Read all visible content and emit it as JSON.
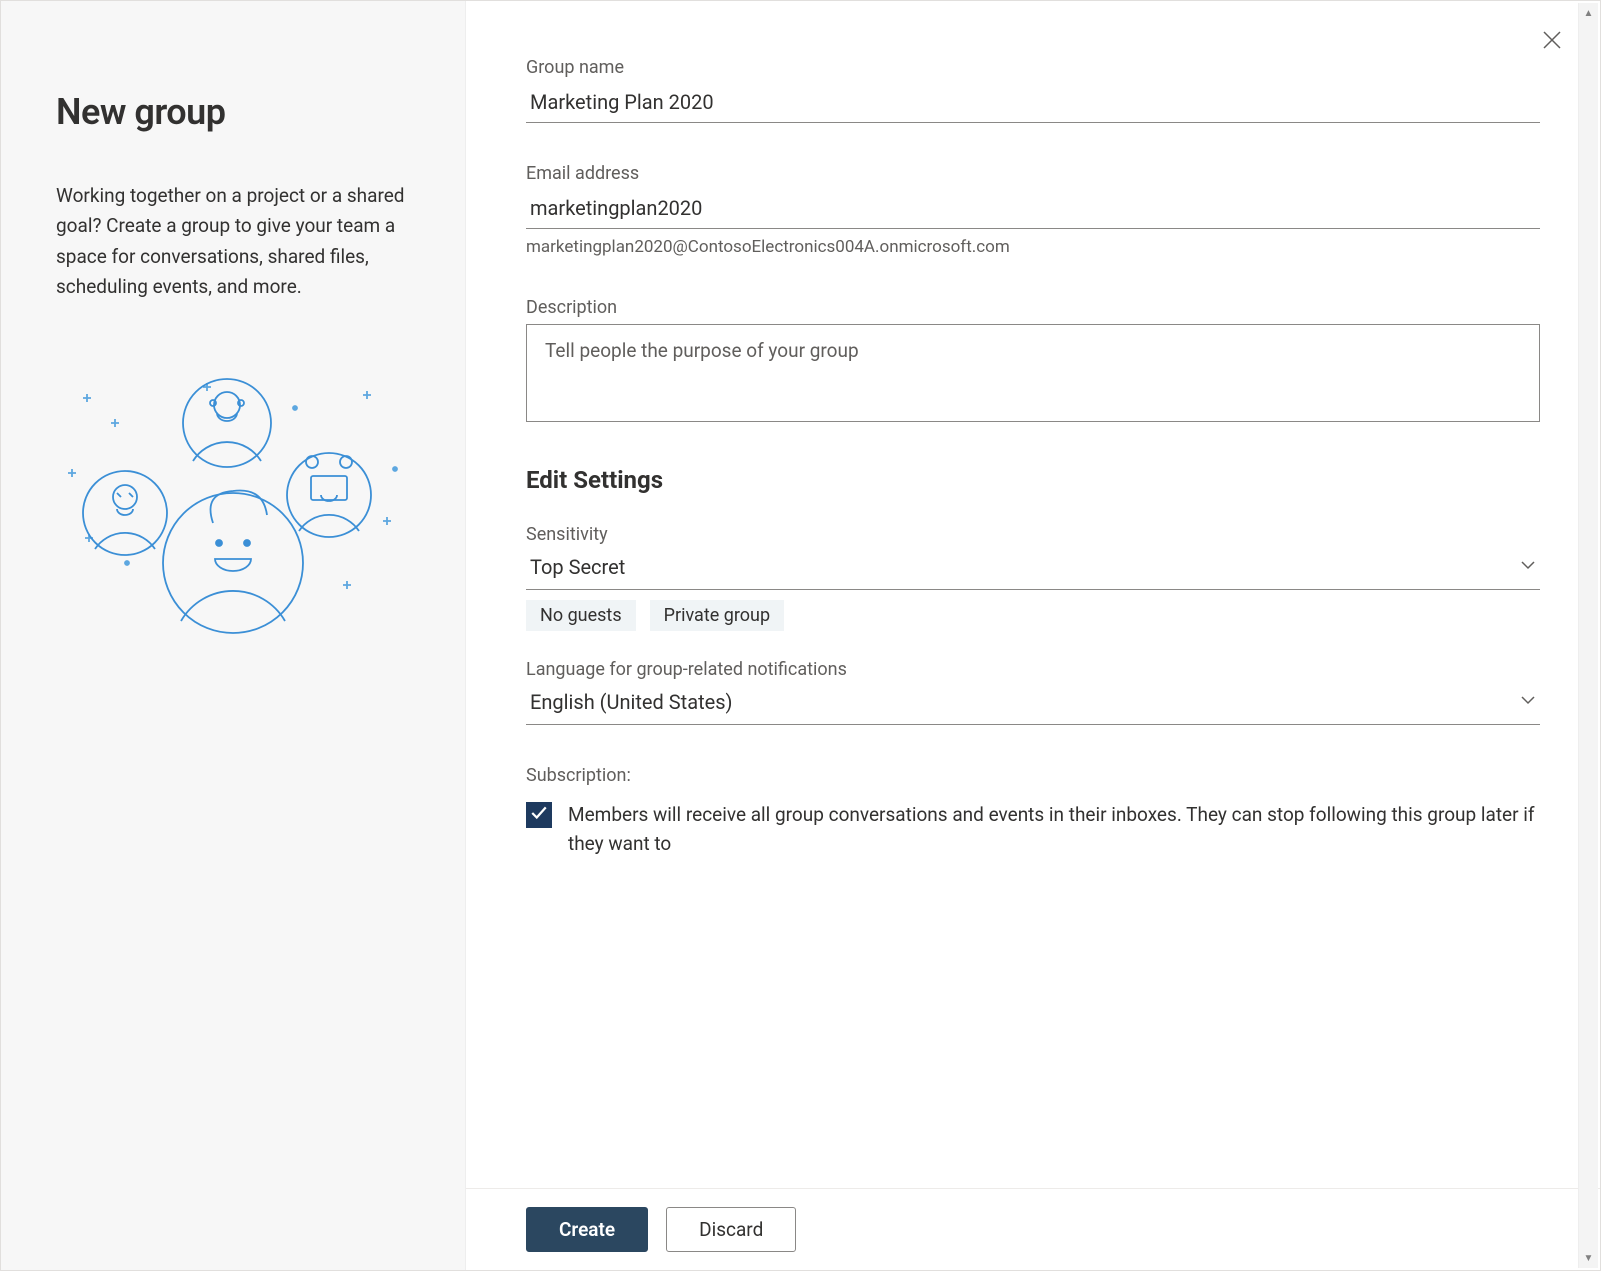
{
  "header": {
    "title": "New group",
    "intro": "Working together on a project or a shared goal? Create a group to give your team a space for conversations, shared files, scheduling events, and more."
  },
  "form": {
    "group_name": {
      "label": "Group name",
      "value": "Marketing Plan 2020"
    },
    "email": {
      "label": "Email address",
      "value": "marketingplan2020",
      "hint": "marketingplan2020@ContosoElectronics004A.onmicrosoft.com"
    },
    "description": {
      "label": "Description",
      "placeholder": "Tell people the purpose of your group"
    },
    "settings_heading": "Edit Settings",
    "sensitivity": {
      "label": "Sensitivity",
      "value": "Top Secret",
      "pills": [
        "No guests",
        "Private group"
      ]
    },
    "language": {
      "label": "Language for group-related notifications",
      "value": "English (United States)"
    },
    "subscription": {
      "label": "Subscription:",
      "checked": true,
      "text": "Members will receive all group conversations and events in their inboxes. They can stop following this group later if they want to"
    }
  },
  "footer": {
    "create_label": "Create",
    "discard_label": "Discard"
  }
}
